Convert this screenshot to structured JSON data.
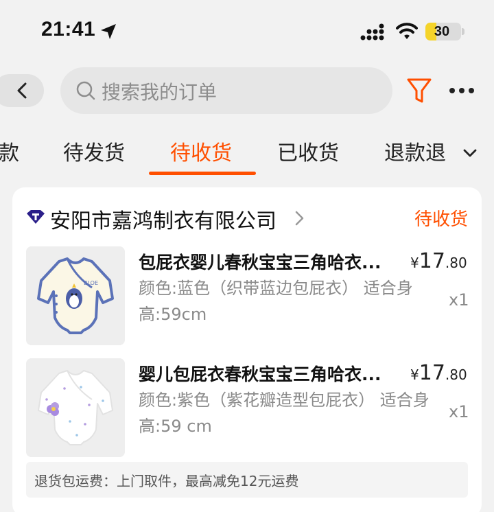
{
  "status_bar": {
    "time": "21:41",
    "battery": "30",
    "battery_level": 0.3
  },
  "header": {
    "search_placeholder": "搜索我的订单",
    "icons": [
      "back-chevron-icon",
      "search-icon",
      "filter-icon",
      "more-icon"
    ]
  },
  "tabs": [
    {
      "label": "款",
      "active": false
    },
    {
      "label": "待发货",
      "active": false
    },
    {
      "label": "待收货",
      "active": true
    },
    {
      "label": "已收货",
      "active": false
    },
    {
      "label": "退款退",
      "active": false
    }
  ],
  "order": {
    "shop_name": "安阳市嘉鸿制衣有限公司",
    "status": "待收货",
    "items": [
      {
        "title": "包屁衣婴儿春秋宝宝三角哈衣...",
        "spec": "颜色:蓝色（织带蓝边包屁衣） 适合身高:59cm",
        "price_symbol": "¥",
        "price_int": "17",
        "price_dec": ".80",
        "qty": "x1"
      },
      {
        "title": "婴儿包屁衣春秋宝宝三角哈衣...",
        "spec": "颜色:紫色（紫花瓣造型包屁衣） 适合身高:59 cm",
        "price_symbol": "¥",
        "price_int": "17",
        "price_dec": ".80",
        "qty": "x1"
      }
    ],
    "notice": "退货包运费：上门取件，最高减免12元运费"
  },
  "colors": {
    "accent": "#ff4f00",
    "background": "#f2f2f2",
    "battery": "#f5d42a"
  }
}
